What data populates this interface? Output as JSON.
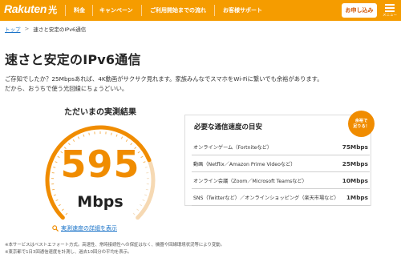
{
  "header": {
    "logo_text": "Rakuten",
    "logo_sub": "光",
    "nav": [
      "料金",
      "キャンペーン",
      "ご利用開始までの流れ",
      "お客様サポート"
    ],
    "apply_label": "お申し込み",
    "menu_label": "メニュー"
  },
  "breadcrumb": {
    "home": "トップ",
    "separator": ">",
    "current": "速さと安定のIPv6通信"
  },
  "page_title": "速さと安定のIPv6通信",
  "intro": [
    "ご存知でしたか？25Mbpsあれば、4K動画がサクサク見れます。家族みんなでスマホをWi-Fiに繋いでも余裕があります。",
    "だから、おうちで使う光回線にちょうどいい。"
  ],
  "result": {
    "title": "ただいまの実測結果",
    "speed": "595",
    "unit": "Mbps",
    "detail_link": "実測速度の詳細を表示",
    "gauge_fill": 0.75
  },
  "speed_card": {
    "title": "必要な通信速度の目安",
    "badge": [
      "余裕で",
      "足りる！"
    ],
    "rows": [
      {
        "label": "オンラインゲーム（Fortniteなど）",
        "value": "75Mbps"
      },
      {
        "label": "動画（Netflix／Amazon Prime Videoなど）",
        "value": "25Mbps"
      },
      {
        "label": "オンライン会議（Zoom／Microsoft Teamsなど）",
        "value": "10Mbps"
      },
      {
        "label": "SNS（Twitterなど）／オンラインショッピング（楽天市場など）",
        "value": "1Mbps"
      }
    ]
  },
  "notes": [
    "※本サービスはベストエフォート方式。高速性、常時接続性への保証はなく、機器や回線環境状況等により変動。",
    "※東京都で1日3回通信速度を計測し、過去10回分の平均を表示。"
  ],
  "colors": {
    "brand_orange": "#f59c00",
    "speed_orange": "#f08c00",
    "link_blue": "#1a73c8",
    "gauge_track": "#f6d9b3"
  },
  "icons": [
    "menu-icon",
    "breadcrumb-chevron-icon",
    "magnifier-icon"
  ]
}
